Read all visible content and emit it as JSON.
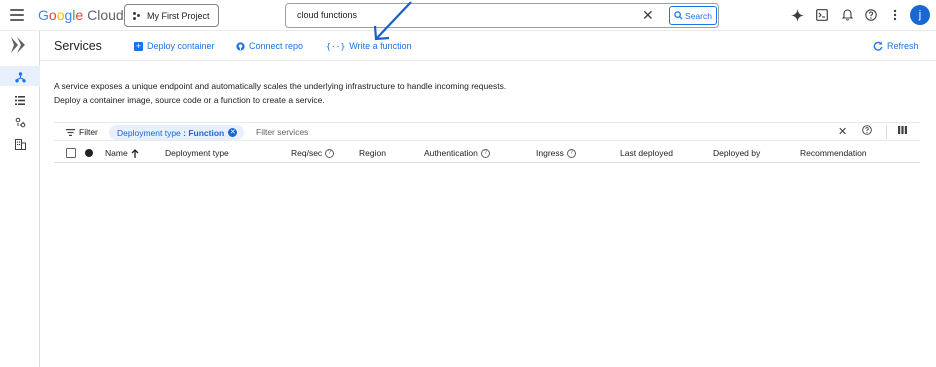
{
  "header": {
    "logo": {
      "google": "Google",
      "cloud": "Cloud"
    },
    "project_label": "My First Project",
    "search": {
      "value": "cloud functions",
      "button_label": "Search"
    },
    "avatar_letter": "j"
  },
  "subheader": {
    "title": "Services",
    "actions": {
      "deploy_container": "Deploy container",
      "connect_repo": "Connect repo",
      "write_function": "Write a function",
      "refresh": "Refresh"
    }
  },
  "description": {
    "line1": "A service exposes a unique endpoint and automatically scales the underlying infrastructure to handle incoming requests.",
    "line2": "Deploy a container image, source code or a function to create a service."
  },
  "filter": {
    "label": "Filter",
    "chip_key": "Deployment type",
    "chip_sep": " : ",
    "chip_value": "Function",
    "placeholder": "Filter services"
  },
  "table": {
    "columns": {
      "name": "Name",
      "deployment_type": "Deployment type",
      "req_sec": "Req/sec",
      "region": "Region",
      "authentication": "Authentication",
      "ingress": "Ingress",
      "last_deployed": "Last deployed",
      "deployed_by": "Deployed by",
      "recommendation": "Recommendation"
    }
  },
  "colors": {
    "accent": "#1a73e8",
    "chip_bg": "#e8f0fe",
    "avatar": "#1967d2"
  }
}
